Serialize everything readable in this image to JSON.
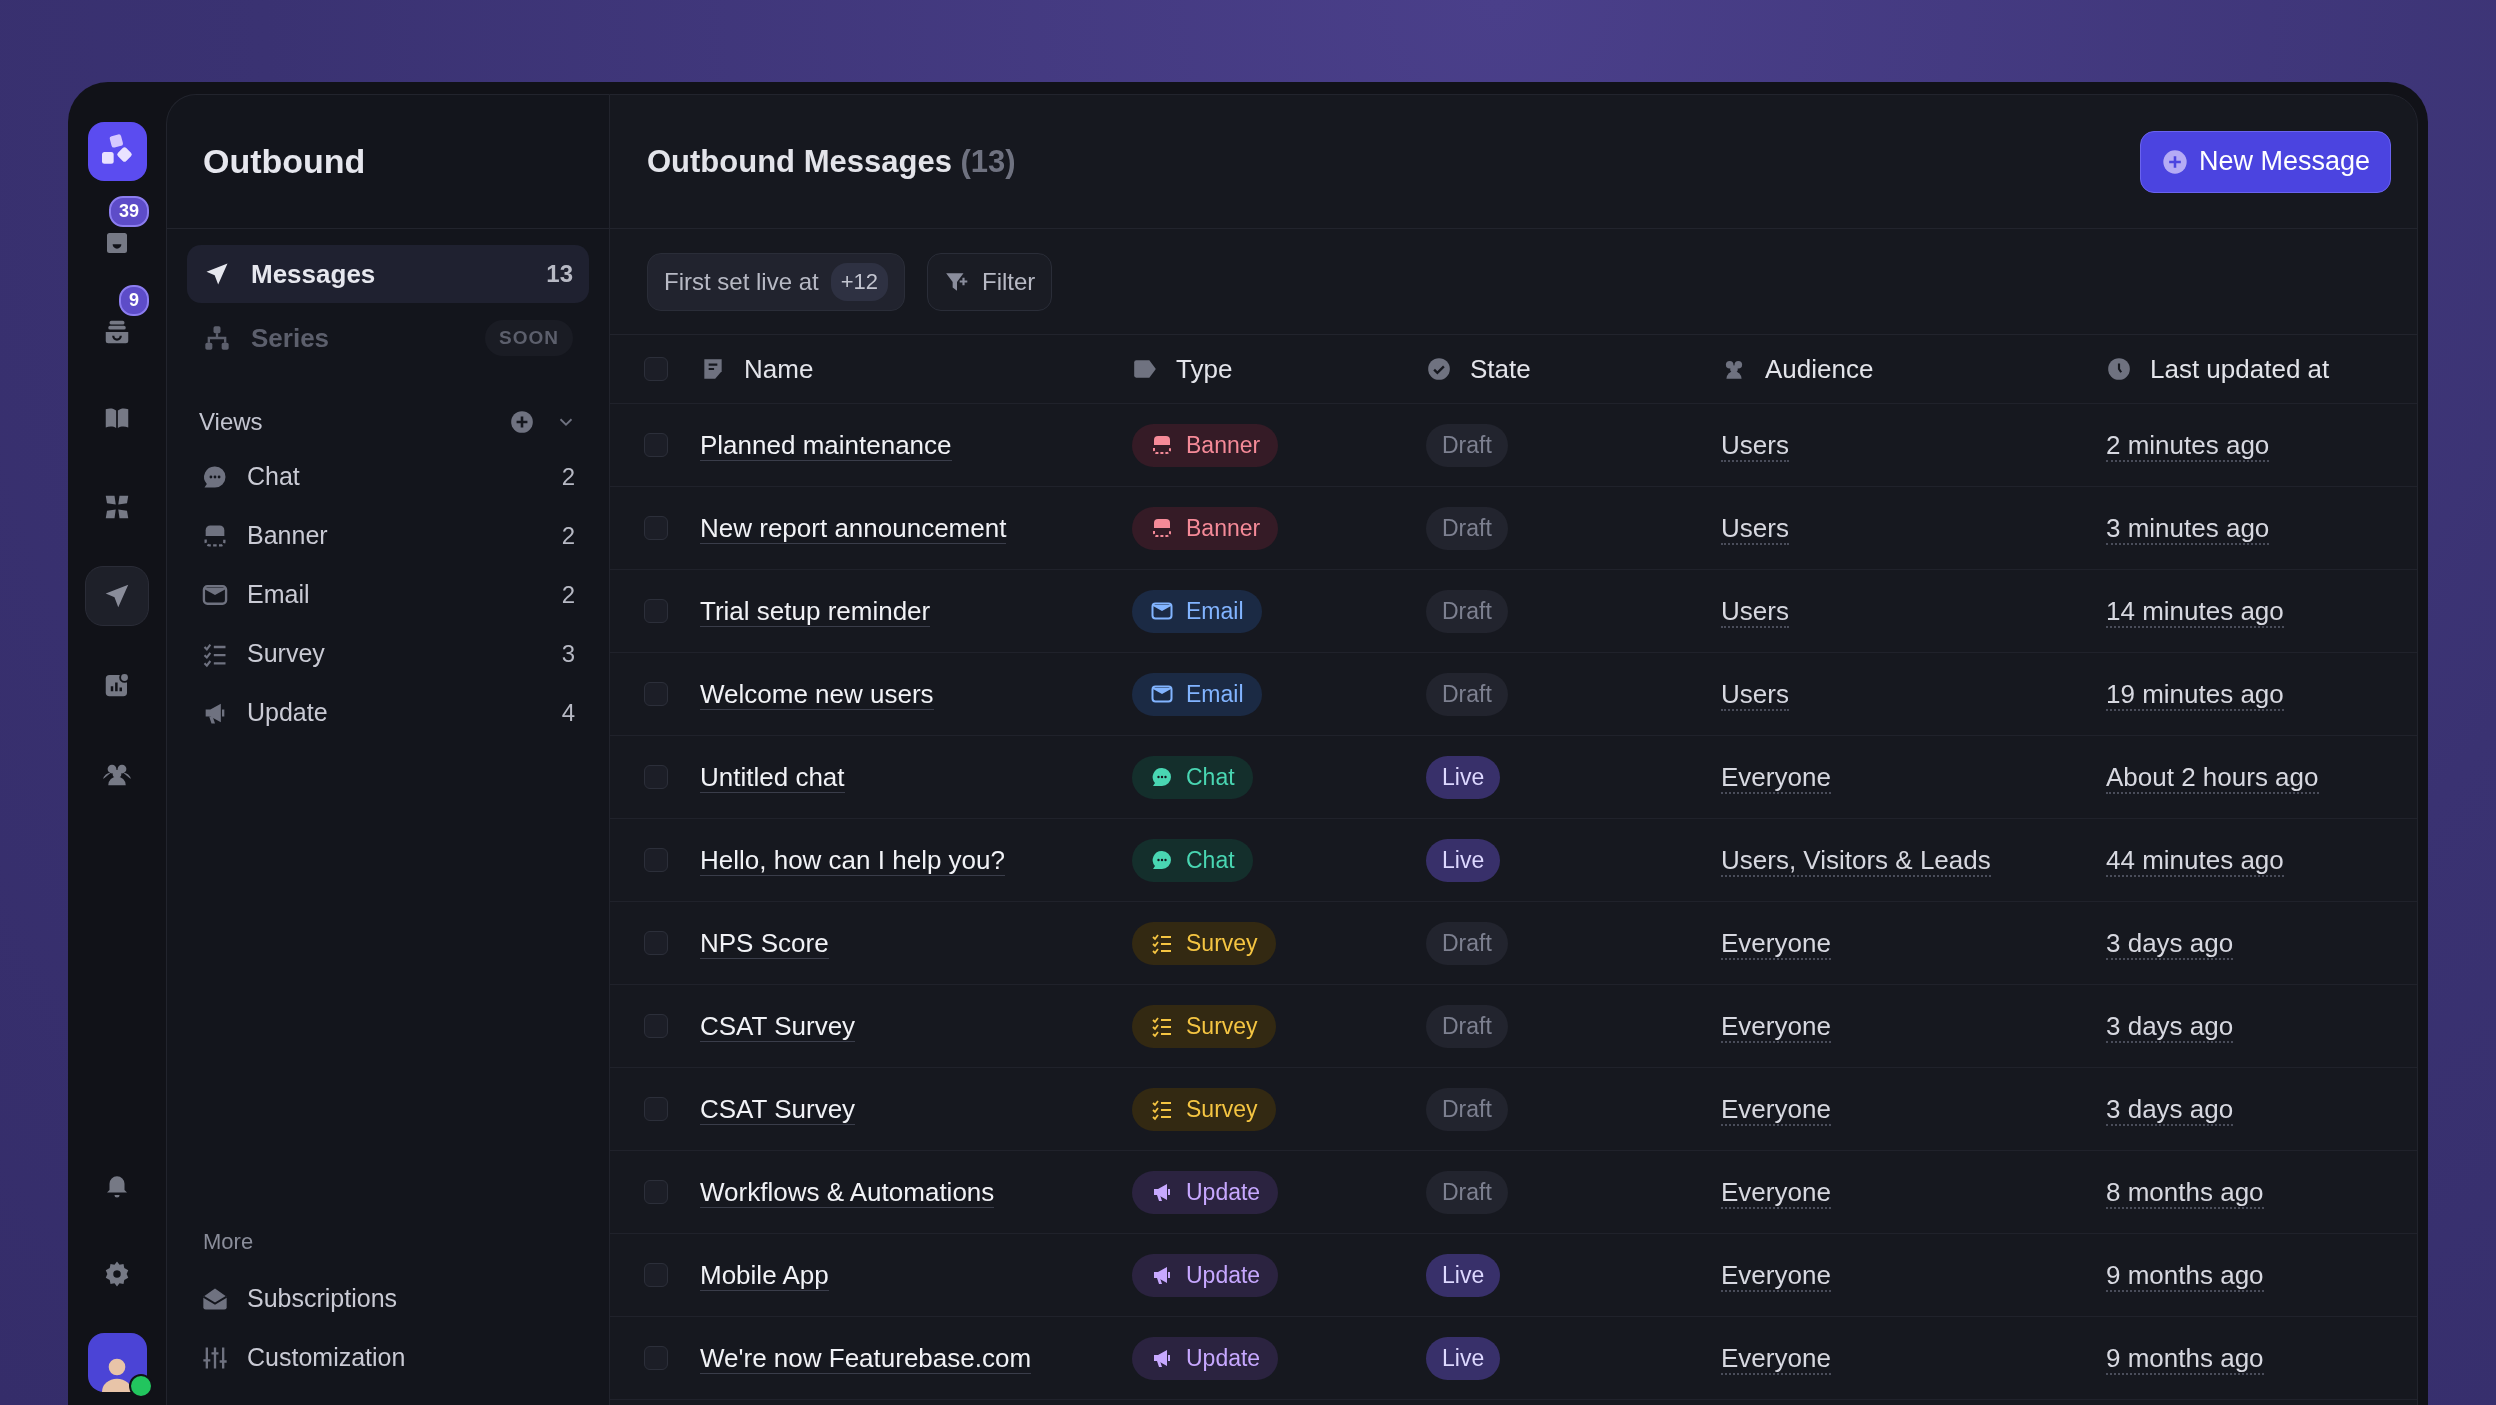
{
  "rail": {
    "items": [
      {
        "kind": "inbox",
        "badge": "39",
        "selected": false
      },
      {
        "kind": "tray",
        "badge": "9",
        "selected": false
      },
      {
        "kind": "book",
        "selected": false
      },
      {
        "kind": "apps",
        "selected": false
      },
      {
        "kind": "send",
        "selected": true
      },
      {
        "kind": "chart",
        "selected": false
      },
      {
        "kind": "people",
        "selected": false
      }
    ],
    "bottom": [
      {
        "kind": "bell"
      },
      {
        "kind": "gear"
      }
    ],
    "avatar": {
      "online": true
    }
  },
  "sidebar": {
    "title": "Outbound",
    "nav": [
      {
        "kind": "send",
        "label": "Messages",
        "count": "13",
        "selected": true,
        "disabled": false
      },
      {
        "kind": "tree",
        "label": "Series",
        "badge": "SOON",
        "selected": false,
        "disabled": true
      }
    ],
    "views": {
      "title": "Views",
      "expanded": true,
      "items": [
        {
          "kind": "chat",
          "label": "Chat",
          "count": "2"
        },
        {
          "kind": "banner",
          "label": "Banner",
          "count": "2"
        },
        {
          "kind": "email",
          "label": "Email",
          "count": "2"
        },
        {
          "kind": "survey",
          "label": "Survey",
          "count": "3"
        },
        {
          "kind": "update",
          "label": "Update",
          "count": "4"
        }
      ]
    },
    "more": {
      "title": "More",
      "items": [
        {
          "kind": "envelope",
          "label": "Subscriptions"
        },
        {
          "kind": "sliders",
          "label": "Customization"
        }
      ]
    }
  },
  "main": {
    "title": "Outbound Messages",
    "count": "(13)",
    "new_button": "New Message",
    "toolbar": {
      "sort": {
        "label": "First set live at",
        "badge": "+12"
      },
      "filter": "Filter"
    },
    "table": {
      "select_all": {
        "checked": false
      },
      "columns": [
        {
          "kind": "name",
          "label": "Name"
        },
        {
          "kind": "type",
          "label": "Type"
        },
        {
          "kind": "state",
          "label": "State"
        },
        {
          "kind": "audience",
          "label": "Audience"
        },
        {
          "kind": "time",
          "label": "Last updated at"
        }
      ],
      "rows": [
        {
          "checked": false,
          "name": "Planned maintenance",
          "type": {
            "kind": "banner",
            "label": "Banner"
          },
          "state": {
            "label": "Draft",
            "live": false
          },
          "audience": "Users",
          "updated": "2 minutes ago"
        },
        {
          "checked": false,
          "name": "New report announcement",
          "type": {
            "kind": "banner",
            "label": "Banner"
          },
          "state": {
            "label": "Draft",
            "live": false
          },
          "audience": "Users",
          "updated": "3 minutes ago"
        },
        {
          "checked": false,
          "name": "Trial setup reminder",
          "type": {
            "kind": "email",
            "label": "Email"
          },
          "state": {
            "label": "Draft",
            "live": false
          },
          "audience": "Users",
          "updated": "14 minutes ago"
        },
        {
          "checked": false,
          "name": "Welcome new users",
          "type": {
            "kind": "email",
            "label": "Email"
          },
          "state": {
            "label": "Draft",
            "live": false
          },
          "audience": "Users",
          "updated": "19 minutes ago"
        },
        {
          "checked": false,
          "name": "Untitled chat",
          "type": {
            "kind": "chat",
            "label": "Chat"
          },
          "state": {
            "label": "Live",
            "live": true
          },
          "audience": "Everyone",
          "updated": "About 2 hours ago"
        },
        {
          "checked": false,
          "name": "Hello, how can I help you?",
          "type": {
            "kind": "chat",
            "label": "Chat"
          },
          "state": {
            "label": "Live",
            "live": true
          },
          "audience": "Users, Visitors & Leads",
          "updated": "44 minutes ago"
        },
        {
          "checked": false,
          "name": "NPS Score",
          "type": {
            "kind": "survey",
            "label": "Survey"
          },
          "state": {
            "label": "Draft",
            "live": false
          },
          "audience": "Everyone",
          "updated": "3 days ago"
        },
        {
          "checked": false,
          "name": "CSAT Survey",
          "type": {
            "kind": "survey",
            "label": "Survey"
          },
          "state": {
            "label": "Draft",
            "live": false
          },
          "audience": "Everyone",
          "updated": "3 days ago"
        },
        {
          "checked": false,
          "name": "CSAT Survey",
          "type": {
            "kind": "survey",
            "label": "Survey"
          },
          "state": {
            "label": "Draft",
            "live": false
          },
          "audience": "Everyone",
          "updated": "3 days ago"
        },
        {
          "checked": false,
          "name": "Workflows & Automations",
          "type": {
            "kind": "update",
            "label": "Update"
          },
          "state": {
            "label": "Draft",
            "live": false
          },
          "audience": "Everyone",
          "updated": "8 months ago"
        },
        {
          "checked": false,
          "name": "Mobile App",
          "type": {
            "kind": "update",
            "label": "Update"
          },
          "state": {
            "label": "Live",
            "live": true
          },
          "audience": "Everyone",
          "updated": "9 months ago"
        },
        {
          "checked": false,
          "name": "We're now Featurebase.com",
          "type": {
            "kind": "update",
            "label": "Update"
          },
          "state": {
            "label": "Live",
            "live": true
          },
          "audience": "Everyone",
          "updated": "9 months ago"
        }
      ]
    }
  }
}
